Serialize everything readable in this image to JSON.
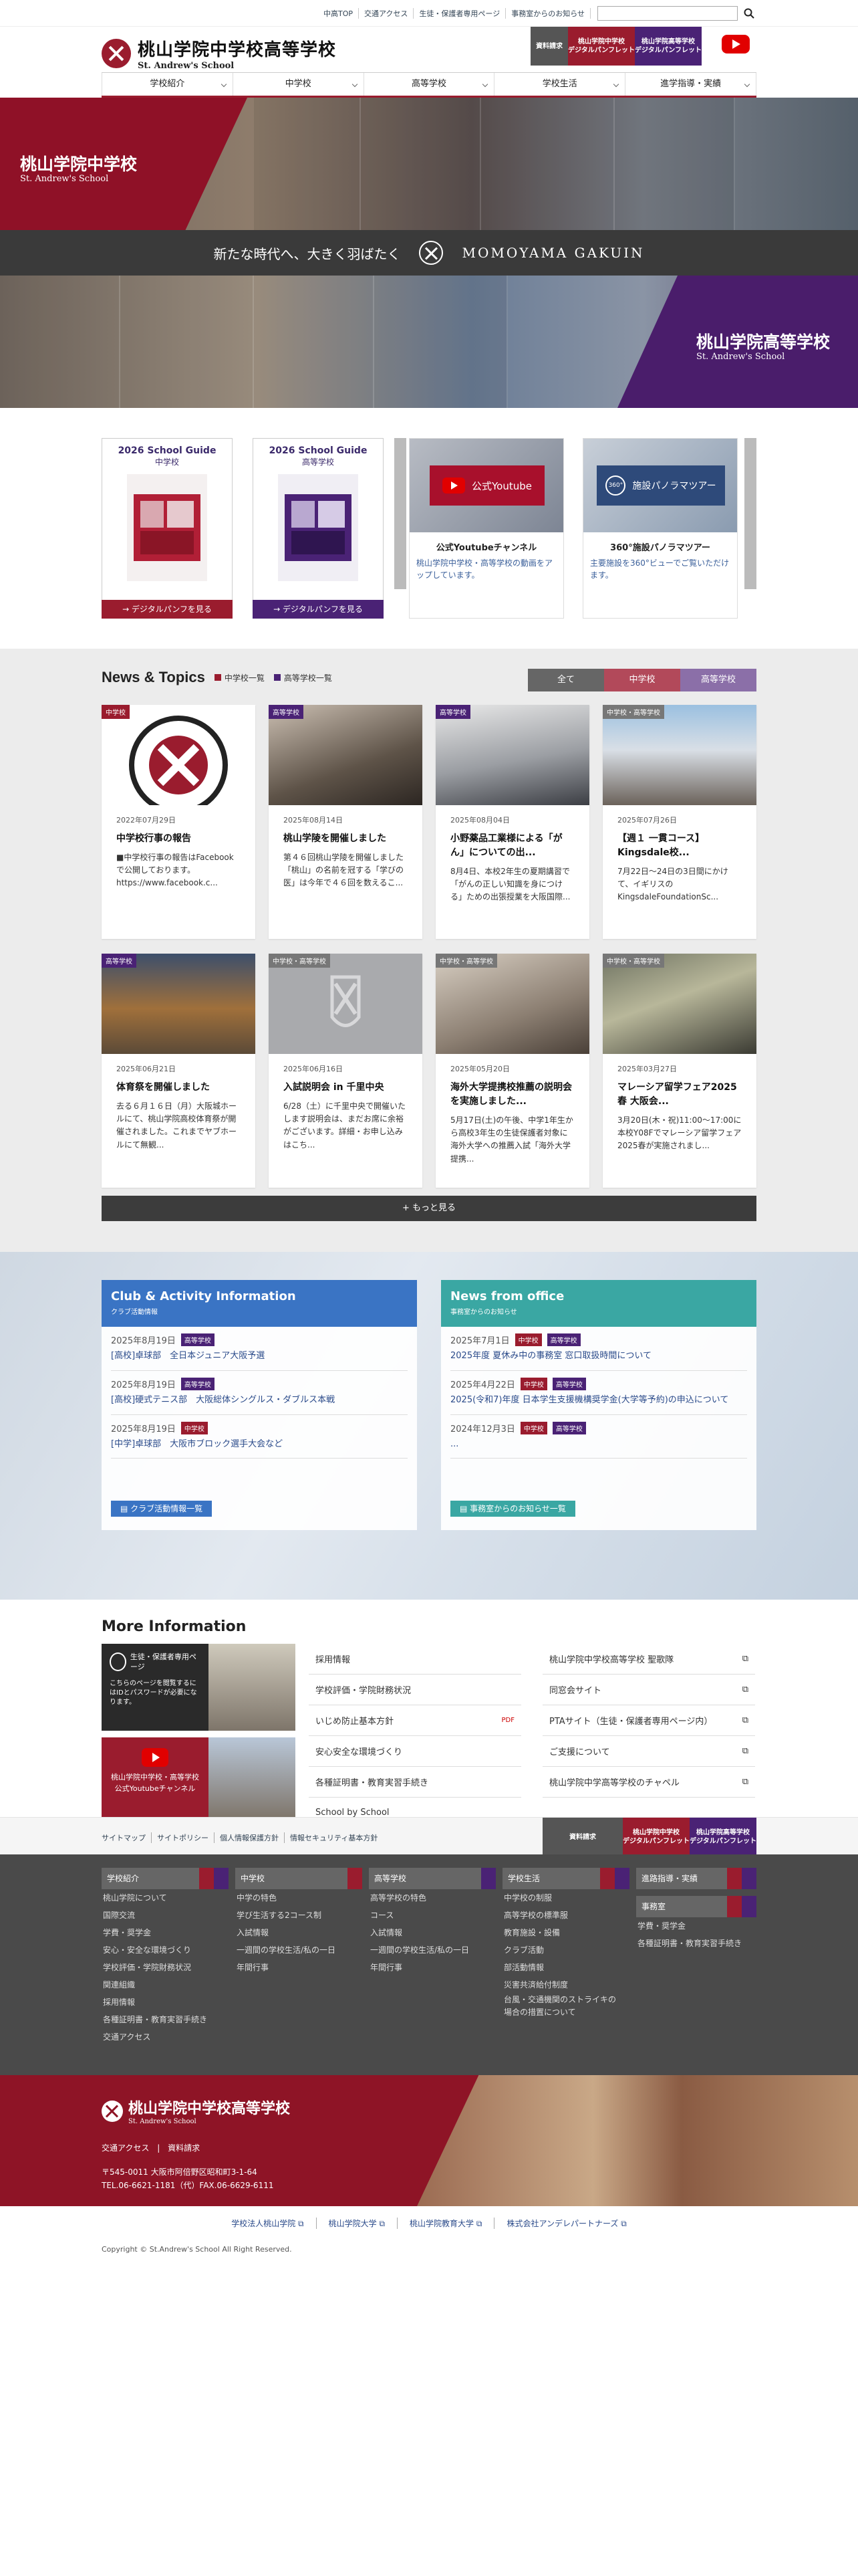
{
  "topbar": {
    "links": [
      "中高TOP",
      "交通アクセス",
      "生徒・保護者専用ページ",
      "事務室からのお知らせ"
    ]
  },
  "header": {
    "logo_jp": "桃山学院中学校高等学校",
    "logo_en": "St. Andrew's School",
    "btn_request": "資料請求",
    "btn_jh_pamphlet": "桃山学院中学校\nデジタルパンフレット",
    "btn_hs_pamphlet": "桃山学院高等学校\nデジタルパンフレット"
  },
  "gnav": [
    "学校紹介",
    "中学校",
    "高等学校",
    "学校生活",
    "進学指導・実績"
  ],
  "hero": {
    "jh_title": "桃山学院中学校",
    "jh_en": "St. Andrew's School",
    "tagline": "新たな時代へ、大きく羽ばたく",
    "brand": "MOMOYAMA GAKUIN",
    "hs_title": "桃山学院高等学校",
    "hs_en": "St. Andrew's School"
  },
  "banners": {
    "jh_guide_t1": "2026 School Guide",
    "jh_guide_t2": "中学校",
    "jh_guide_btn": "→ デジタルパンフを見る",
    "hs_guide_t1": "2026 School Guide",
    "hs_guide_t2": "高等学校",
    "hs_guide_btn": "→ デジタルパンフを見る",
    "yt_label": "公式Youtube",
    "yt_title": "公式Youtubeチャンネル",
    "yt_desc": "桃山学院中学校・高等学校の動画をアップしています。",
    "pano_label": "施設パノラマツアー",
    "pano_title": "360°施設パノラマツアー",
    "pano_desc": "主要施設を360°ビューでご覧いただけます。"
  },
  "news": {
    "title": "News & Topics",
    "link_jh": "中学校一覧",
    "link_hs": "高等学校一覧",
    "filters": [
      "全て",
      "中学校",
      "高等学校"
    ],
    "items": [
      {
        "badge": "中学校",
        "date": "2022年07月29日",
        "title": "中学校行事の報告",
        "body": "■中学校行事の報告はFacebookで公開しております。 https://www.facebook.c..."
      },
      {
        "badge": "高等学校",
        "date": "2025年08月14日",
        "title": "桃山学陵を開催しました",
        "body": "第４６回桃山学陵を開催しました「桃山」の名前を冠する「学びの医」は今年で４６回を数えるこ..."
      },
      {
        "badge": "高等学校",
        "date": "2025年08月04日",
        "title": "小野薬品工業様による「がん」についての出...",
        "body": "8月4日、本校2年生の夏期講習で「がんの正しい知識を身につける」ための出張授業を大阪国際..."
      },
      {
        "badge": "中学校・高等学校",
        "date": "2025年07月26日",
        "title": "【週１ 一貫コース】 Kingsdale校...",
        "body": "7月22日〜24日の3日間にかけて、イギリスのKingsdaleFoundationSc..."
      },
      {
        "badge": "高等学校",
        "date": "2025年06月21日",
        "title": "体育祭を開催しました",
        "body": "去る６月１６日（月）大阪城ホールにて、桃山学院高校体育祭が開催されました。これまでヤブホールにて無観..."
      },
      {
        "badge": "中学校・高等学校",
        "date": "2025年06月16日",
        "title": "入試説明会 in 千里中央",
        "body": "6/28（土）に千里中央で開催いたします説明会は、まだお席に余裕がございます。詳細・お申し込みはこち..."
      },
      {
        "badge": "中学校・高等学校",
        "date": "2025年05月20日",
        "title": "海外大学提携校推薦の説明会を実施しました...",
        "body": "5月17日(土)の午後、中学1年生から高校3年生の生徒保護者対象に海外大学への推薦入試「海外大学提携..."
      },
      {
        "badge": "中学校・高等学校",
        "date": "2025年03月27日",
        "title": "マレーシア留学フェア2025春 大阪会...",
        "body": "3月20日(木・祝)11:00〜17:00に本校Y08Fでマレーシア留学フェア2025春が実施されまし..."
      }
    ],
    "more": "もっと見る"
  },
  "club": {
    "title": "Club & Activity Information",
    "subtitle": "クラブ活動情報",
    "entries": [
      {
        "date": "2025年8月19日",
        "label": "高等学校",
        "text": "[高校]卓球部　全日本ジュニア大阪予選"
      },
      {
        "date": "2025年8月19日",
        "label": "高等学校",
        "text": "[高校]硬式テニス部　大阪総体シングルス・ダブルス本戦"
      },
      {
        "date": "2025年8月19日",
        "label": "中学校",
        "text": "[中学]卓球部　大阪市ブロック選手大会など"
      }
    ],
    "btn": "クラブ活動情報一覧"
  },
  "office": {
    "title": "News from office",
    "subtitle": "事務室からのお知らせ",
    "entries": [
      {
        "date": "2025年7月1日",
        "label1": "中学校",
        "label2": "高等学校",
        "text": "2025年度 夏休み中の事務室 窓口取扱時間について"
      },
      {
        "date": "2025年4月22日",
        "label1": "中学校",
        "label2": "高等学校",
        "text": "2025(令和7)年度 日本学生支援機構奨学金(大学等予約)の申込について"
      },
      {
        "date": "2024年12月3日",
        "label1": "中学校",
        "label2": "高等学校",
        "text": "..."
      }
    ],
    "btn": "事務室からのお知らせ一覧"
  },
  "moreinfo": {
    "title": "More Information",
    "ban1_label": "生徒・保護者専用ページ",
    "ban1_text": "こちらのページを閲覧するにはIDとパスワードが必要になります。",
    "ban2_label": "桃山学院中学校・高等学校公式Youtubeチャンネル",
    "col1": [
      "採用情報",
      "学校評価・学院財務状況",
      "いじめ防止基本方針",
      "安心安全な環境づくり",
      "各種証明書・教育実習手続き",
      "School by School"
    ],
    "col2": [
      "桃山学院中学校高等学校 聖歌隊",
      "同窓会サイト",
      "PTAサイト（生徒・保護者専用ページ内）",
      "ご支援について",
      "桃山学院中学高等学校のチャペル"
    ]
  },
  "footer": {
    "links": [
      "サイトマップ",
      "サイトポリシー",
      "個人情報保護方針",
      "情報セキュリティ基本方針"
    ],
    "btn_request": "資料請求",
    "btn_jh": "桃山学院中学校\nデジタルパンフレット",
    "btn_hs": "桃山学院高等学校\nデジタルパンフレット",
    "cols": [
      {
        "head": "学校紹介",
        "items": [
          "桃山学院について",
          "国際交流",
          "学費・奨学金",
          "安心・安全な環境づくり",
          "学校評価・学院財務状況",
          "関連組織",
          "採用情報",
          "各種証明書・教育実習手続き",
          "交通アクセス"
        ]
      },
      {
        "head": "中学校",
        "items": [
          "中学の特色",
          "学び生活する2コース制",
          "入試情報",
          "一週間の学校生活/私の一日",
          "年間行事"
        ]
      },
      {
        "head": "高等学校",
        "items": [
          "高等学校の特色",
          "コース",
          "入試情報",
          "一週間の学校生活/私の一日",
          "年間行事"
        ]
      },
      {
        "head": "学校生活",
        "items": [
          "中学校の制服",
          "高等学校の標準服",
          "教育施設・設備",
          "クラブ活動",
          "部活動情報",
          "災害共済給付制度",
          "台風・交通機関のストライキの場合の措置について"
        ]
      },
      {
        "head": "進路指導・実績",
        "items": []
      },
      {
        "head": "事務室",
        "items": [
          "学費・奨学金",
          "各種証明書・教育実習手続き"
        ]
      }
    ],
    "logo_jp": "桃山学院中学校高等学校",
    "logo_en": "St. Andrew's School",
    "access": "交通アクセス",
    "request": "資料請求",
    "address": "〒545-0011 大阪市阿倍野区昭和町3-1-64",
    "tel": "TEL.06-6621-1181（代）FAX.06-6629-6111",
    "ext": [
      "学校法人桃山学院",
      "桃山学院大学",
      "桃山学院教育大学",
      "株式会社アンデレパートナーズ"
    ],
    "copyright": "Copyright © St.Andrew's School All Right Reserved."
  },
  "colors": {
    "maroon": "#9a1c2e",
    "purple": "#4a2275",
    "blue": "#3a74c4",
    "teal": "#3aa7a3"
  }
}
